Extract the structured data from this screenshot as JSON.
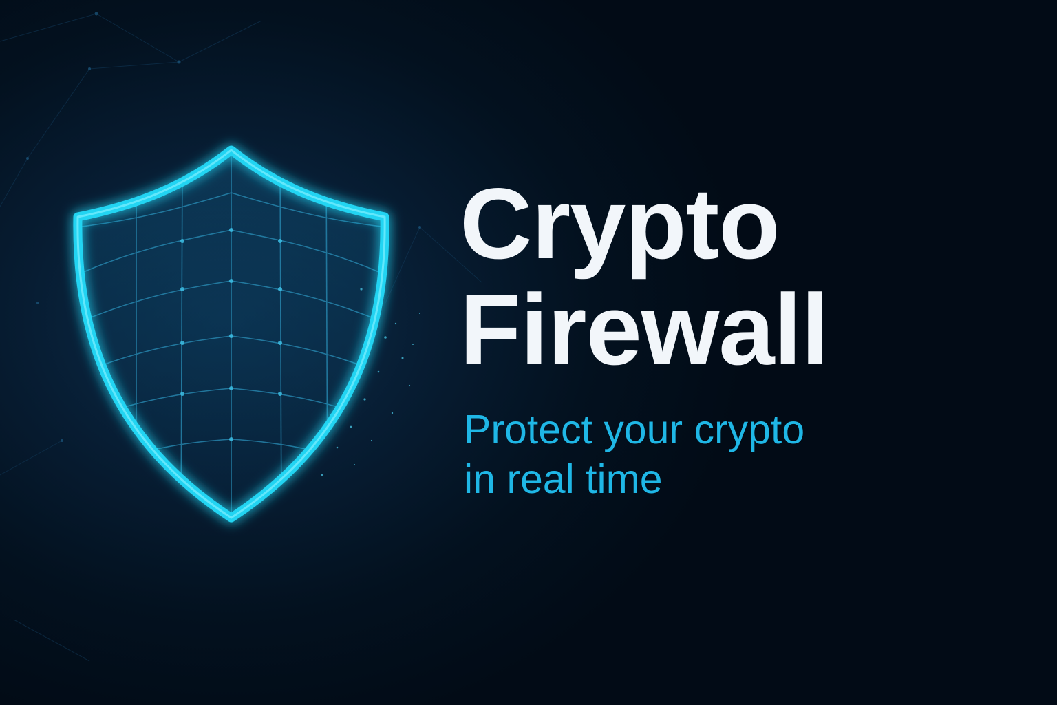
{
  "headline": {
    "line1": "Crypto",
    "line2": "Firewall"
  },
  "tagline": {
    "line1": "Protect your crypto",
    "line2": "in real time"
  },
  "icons": {
    "shield": "shield-icon"
  },
  "colors": {
    "background": "#020d1c",
    "headline": "#f2f6fa",
    "tagline": "#1fb7e6",
    "shield_glow": "#23d4f2"
  }
}
